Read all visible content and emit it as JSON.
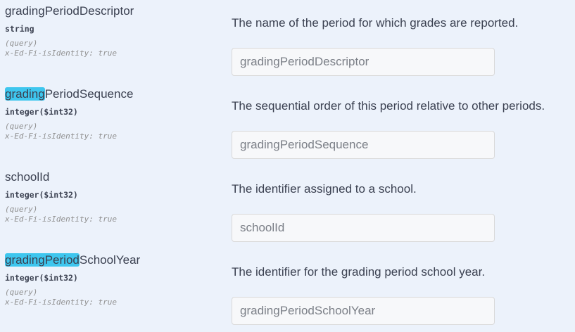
{
  "parameters": [
    {
      "name_highlight": "",
      "name_rest": "gradingPeriodDescriptor",
      "type": "string",
      "in": "(query)",
      "extension": "x-Ed-Fi-isIdentity: true",
      "description": "The name of the period for which grades are reported.",
      "placeholder": "gradingPeriodDescriptor",
      "value": ""
    },
    {
      "name_highlight": "grading",
      "name_rest": "PeriodSequence",
      "type": "integer($int32)",
      "in": "(query)",
      "extension": "x-Ed-Fi-isIdentity: true",
      "description": "The sequential order of this period relative to other periods.",
      "placeholder": "gradingPeriodSequence",
      "value": ""
    },
    {
      "name_highlight": "",
      "name_rest": "schoolId",
      "type": "integer($int32)",
      "in": "(query)",
      "extension": "x-Ed-Fi-isIdentity: true",
      "description": "The identifier assigned to a school.",
      "placeholder": "schoolId",
      "value": ""
    },
    {
      "name_highlight": "gradingPeriod",
      "name_rest": "SchoolYear",
      "type": "integer($int32)",
      "in": "(query)",
      "extension": "x-Ed-Fi-isIdentity: true",
      "description": "The identifier for the grading period school year.",
      "placeholder": "gradingPeriodSchoolYear",
      "value": ""
    }
  ],
  "colors": {
    "background": "#ecf2fb",
    "highlight": "#3ec6ee",
    "text": "#3b4151",
    "muted": "#909090"
  }
}
